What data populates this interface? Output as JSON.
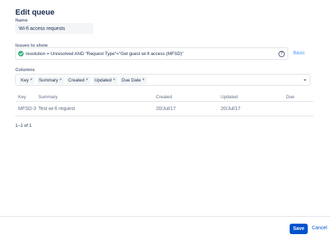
{
  "dialog": {
    "title": "Edit queue"
  },
  "name_field": {
    "label": "Name",
    "value": "Wi-fi access requests"
  },
  "issues_field": {
    "label": "Issues to show",
    "jql": "resolution = Unresolved AND \"Request Type\"=\"Get guest wi-fi access (MFSD)\"",
    "help_glyph": "?",
    "valid_icon": "check-circle-icon",
    "mode_link": "Basic"
  },
  "columns_field": {
    "label": "Columns",
    "tags": [
      "Key",
      "Summary",
      "Created",
      "Updated",
      "Due Date"
    ],
    "remove_glyph": "×"
  },
  "table": {
    "headers": [
      "Key",
      "Summary",
      "Created",
      "Updated",
      "Due"
    ],
    "rows": [
      {
        "key": "MFSD-3",
        "summary": "Test wi-fi request",
        "created": "20/Jul/17",
        "updated": "20/Jul/17",
        "due": ""
      }
    ]
  },
  "pager": {
    "text": "1–1 of 1"
  },
  "footer": {
    "save_label": "Save",
    "cancel_label": "Cancel"
  },
  "colors": {
    "primary": "#0052cc",
    "link": "#4c9aff",
    "success": "#36b37e",
    "border": "#dfe1e6",
    "muted_text": "#5e6c84"
  }
}
